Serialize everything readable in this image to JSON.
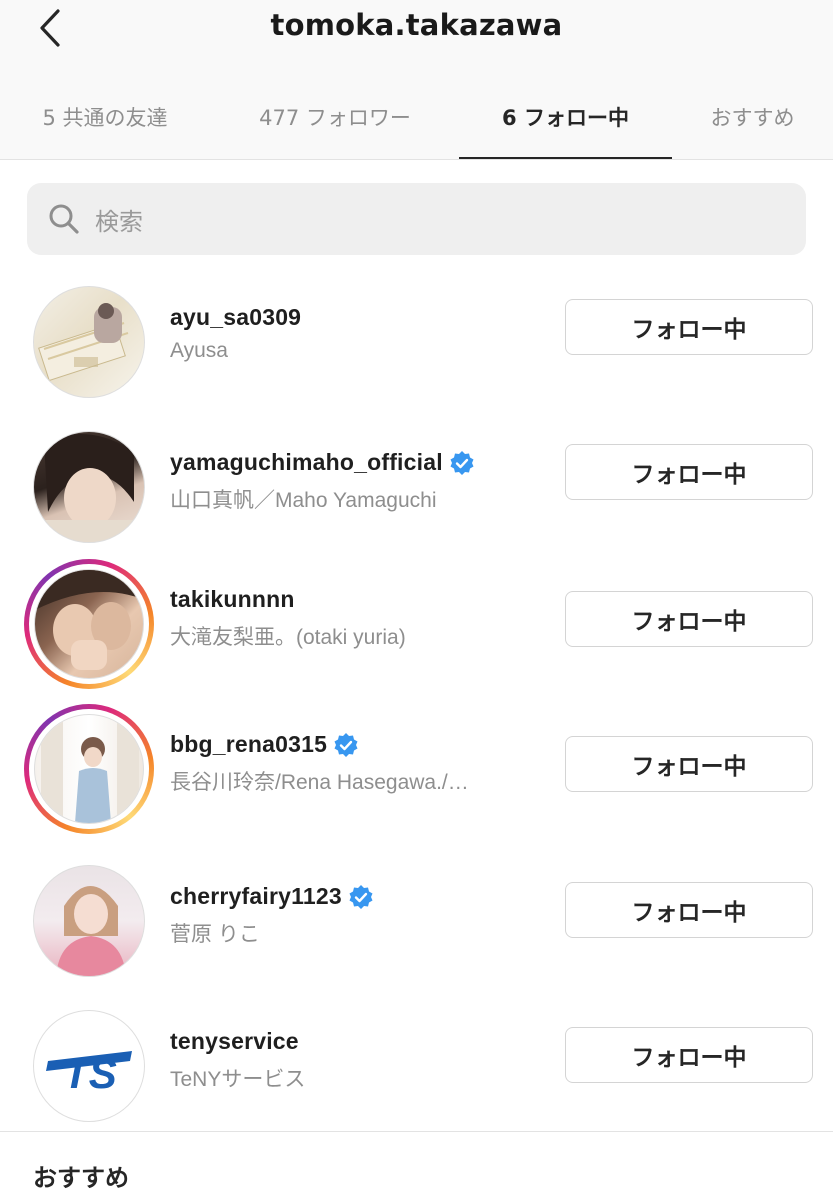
{
  "header": {
    "title": "tomoka.takazawa",
    "back_icon": "chevron-left-icon"
  },
  "tabs": [
    {
      "label": "5 共通の友達",
      "active": false
    },
    {
      "label": "477 フォロワー",
      "active": false
    },
    {
      "label": "6 フォロー中",
      "active": true
    },
    {
      "label": "おすすめ",
      "active": false
    }
  ],
  "search": {
    "placeholder": "検索",
    "icon": "search-icon"
  },
  "following": [
    {
      "username": "ayu_sa0309",
      "full_name": "Ayusa",
      "verified": false,
      "story_ring": false,
      "button_label": "フォロー中",
      "avatar": "photo-avatar"
    },
    {
      "username": "yamaguchimaho_official",
      "full_name": "山口真帆／Maho Yamaguchi",
      "verified": true,
      "story_ring": false,
      "button_label": "フォロー中",
      "avatar": "photo-avatar"
    },
    {
      "username": "takikunnnn",
      "full_name": "大滝友梨亜。(otaki yuria)",
      "verified": false,
      "story_ring": true,
      "button_label": "フォロー中",
      "avatar": "photo-avatar"
    },
    {
      "username": "bbg_rena0315",
      "full_name": "長谷川玲奈/Rena Hasegawa./…",
      "verified": true,
      "story_ring": true,
      "button_label": "フォロー中",
      "avatar": "photo-avatar"
    },
    {
      "username": "cherryfairy1123",
      "full_name": "菅原 りこ",
      "verified": true,
      "story_ring": false,
      "button_label": "フォロー中",
      "avatar": "photo-avatar"
    },
    {
      "username": "tenyservice",
      "full_name": "TeNYサービス",
      "verified": false,
      "story_ring": false,
      "button_label": "フォロー中",
      "avatar": "logo-avatar",
      "logo_text": "TS"
    }
  ],
  "suggested_section": {
    "title": "おすすめ"
  },
  "colors": {
    "verified_badge": "#3897f0",
    "story_ring_start": "#f58529",
    "story_ring_end": "#8134af",
    "logo_blue": "#1a5fb4"
  }
}
